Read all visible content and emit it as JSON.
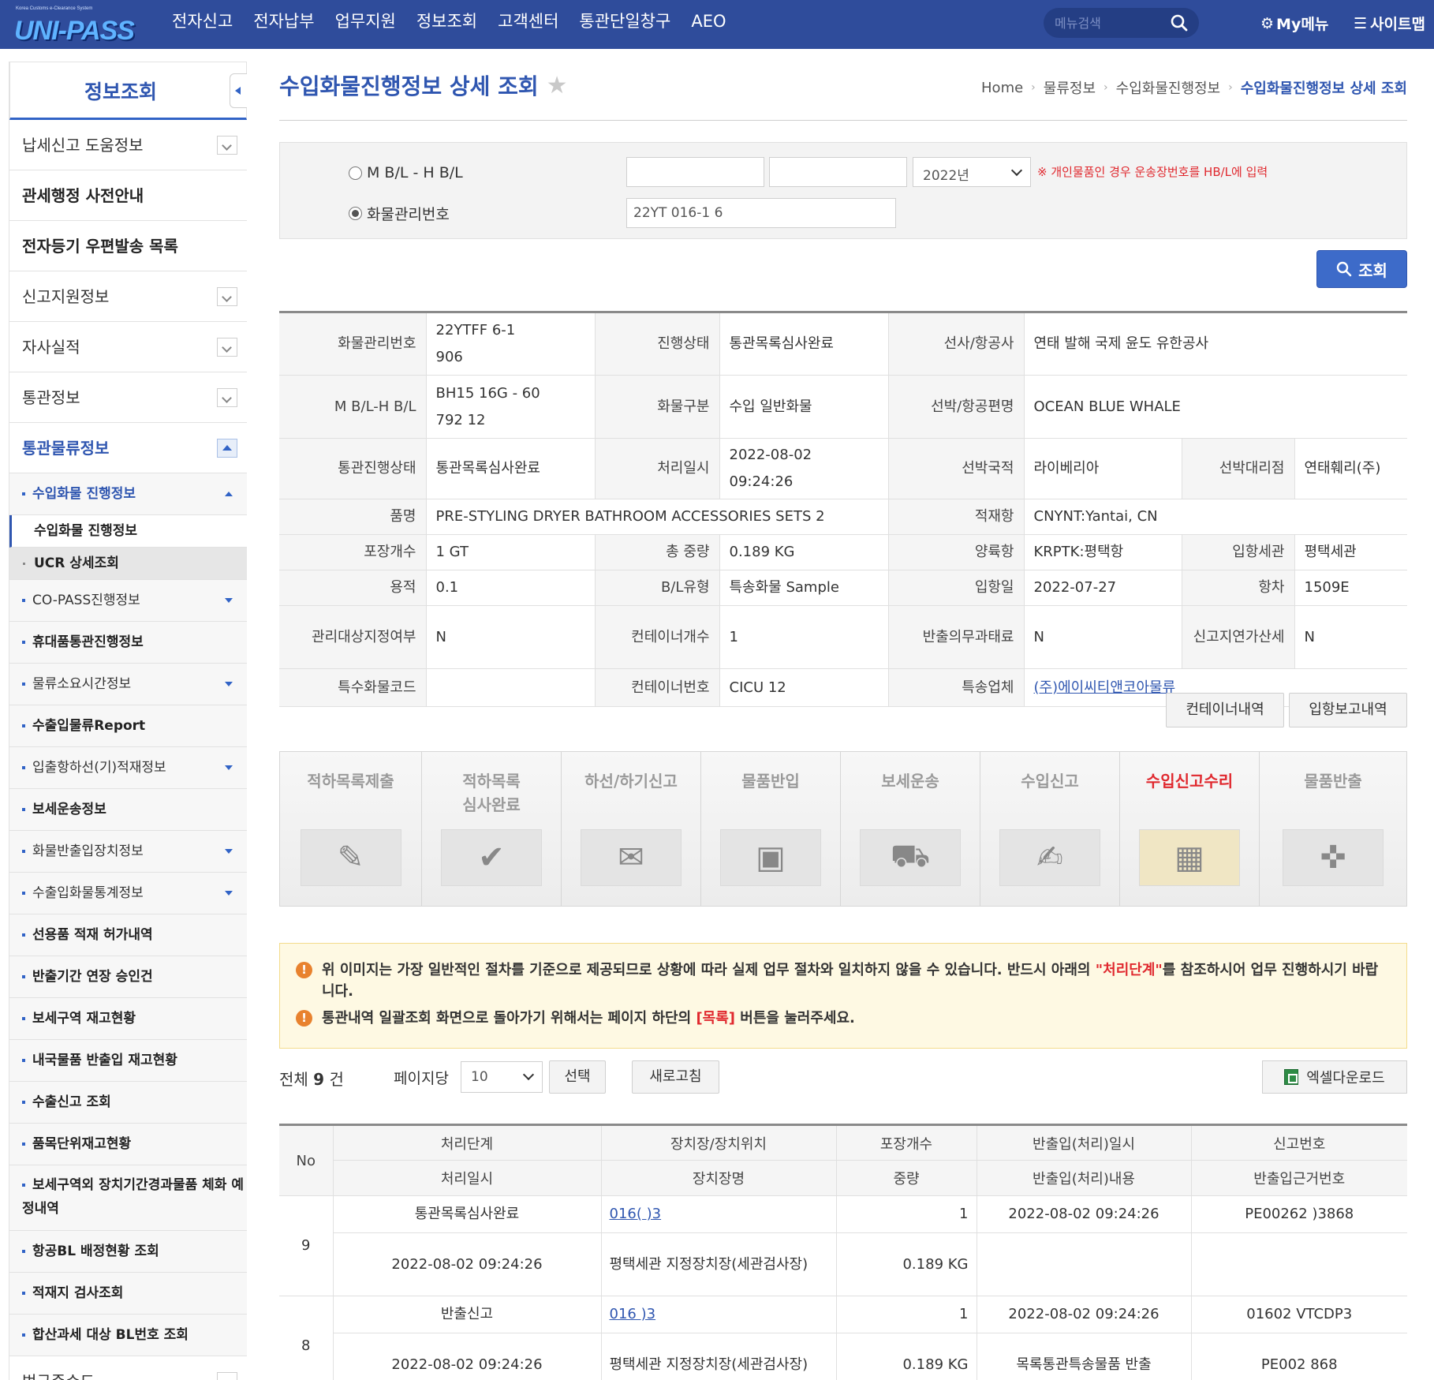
{
  "header": {
    "logo_small": "Korea Customs e-Clearance System",
    "logo_text": "UNI-PASS",
    "nav": [
      "전자신고",
      "전자납부",
      "업무지원",
      "정보조회",
      "고객센터",
      "통관단일창구",
      "AEO"
    ],
    "search_placeholder": "메뉴검색",
    "mymenu": "My메뉴",
    "sitemap": "사이트맵"
  },
  "sidebar": {
    "title": "정보조회",
    "items": [
      {
        "label": "납세신고 도움정보",
        "toggle": "down"
      },
      {
        "label": "관세행정 사전안내",
        "bold": true
      },
      {
        "label": "전자등기 우편발송 목록",
        "bold": true
      },
      {
        "label": "신고지원정보",
        "toggle": "down"
      },
      {
        "label": "자사실적",
        "toggle": "down"
      },
      {
        "label": "통관정보",
        "toggle": "down"
      },
      {
        "label": "통관물류정보",
        "toggle": "up",
        "active": true
      }
    ],
    "sub_open": "수입화물 진행정보",
    "sub_children": [
      "수입화물 진행정보",
      "UCR 상세조회"
    ],
    "subs": [
      "CO-PASS진행정보",
      "휴대품통관진행정보",
      "물류소요시간정보",
      "수출입물류Report",
      "입출항하선(기)적재정보",
      "보세운송정보",
      "화물반출입장치정보",
      "수출입화물통계정보",
      "선용품 적재 허가내역",
      "반출기간 연장 승인건",
      "보세구역 재고현황",
      "내국물품 반출입 재고현황",
      "수출신고 조회",
      "품목단위재고현황",
      "보세구역외 장치기간경과물품 체화 예정내역",
      "항공BL 배정현황 조회",
      "적재지 검사조회",
      "합산과세 대상 BL번호 조회"
    ],
    "last": "법규준수도"
  },
  "page": {
    "title": "수입화물진행정보 상세 조회",
    "breadcrumb": [
      "Home",
      "물류정보",
      "수입화물진행정보",
      "수입화물진행정보 상세 조회"
    ]
  },
  "search": {
    "radio1": "M B/L - H B/L",
    "radio2": "화물관리번호",
    "mbl": "",
    "hbl": "",
    "year": "2022년",
    "note": "※ 개인물품인 경우 운송장번호를 HB/L에 입력",
    "cargo_no": "22YT          016-1   6",
    "button": "조회"
  },
  "info": {
    "labels": {
      "cargo_no": "화물관리번호",
      "status": "진행상태",
      "carrier": "선사/항공사",
      "bl": "M B/L-H B/L",
      "cargo_type": "화물구분",
      "vessel": "선박/항공편명",
      "clearance": "통관진행상태",
      "proc_date": "처리일시",
      "nation": "선박국적",
      "agent": "선박대리점",
      "item": "품명",
      "load_port": "적재항",
      "pkg": "포장개수",
      "weight": "총 중량",
      "unload_port": "양륙항",
      "customs": "입항세관",
      "volume": "용적",
      "bl_type": "B/L유형",
      "arrival": "입항일",
      "voyage": "항차",
      "mgmt": "관리대상지정여부",
      "cntr_cnt": "컨테이너개수",
      "penalty": "반출의무과태료",
      "late": "신고지연가산세",
      "special": "특수화물코드",
      "cntr_no": "컨테이너번호",
      "courier": "특송업체"
    },
    "values": {
      "cargo_no": "22YTFF              6-1\n906",
      "status": "통관목록심사완료",
      "carrier": "연태 발해 국제 윤도 유한공사",
      "bl": "BH15        16G - 60\n792         12",
      "cargo_type": "수입 일반화물",
      "vessel": "OCEAN BLUE WHALE",
      "clearance": "통관목록심사완료",
      "proc_date": "2022-08-02 09:24:26",
      "nation": "라이베리아",
      "agent": "연태훼리(주)",
      "item": "PRE-STYLING DRYER BATHROOM ACCESSORIES SETS 2",
      "load_port": "CNYNT:Yantai, CN",
      "pkg": "1 GT",
      "weight": "0.189 KG",
      "unload_port": "KRPTK:평택항",
      "customs": "평택세관",
      "volume": "0.1",
      "bl_type": "특송화물 Sample",
      "arrival": "2022-07-27",
      "voyage": "1509E",
      "mgmt": "N",
      "cntr_cnt": "1",
      "penalty": "N",
      "late": "N",
      "special": "",
      "cntr_no": "CICU        12",
      "courier": "(주)에이씨티앤코아물류"
    }
  },
  "buttons": {
    "container": "컨테이너내역",
    "arrival_report": "입항보고내역"
  },
  "steps": [
    {
      "label": "적하목록제출",
      "icon": "✎"
    },
    {
      "label": "적하목록\n심사완료",
      "icon": "✔"
    },
    {
      "label": "하선/하기신고",
      "icon": "✉"
    },
    {
      "label": "물품반입",
      "icon": "▣"
    },
    {
      "label": "보세운송",
      "icon": "⛟"
    },
    {
      "label": "수입신고",
      "icon": "✍"
    },
    {
      "label": "수입신고수리",
      "icon": "▦",
      "active": true
    },
    {
      "label": "물품반출",
      "icon": "✜"
    }
  ],
  "notice": {
    "line1_a": "위 이미지는 가장 일반적인 절차를 기준으로 제공되므로 상황에 따라 실제 업무 절차와 일치하지 않을 수 있습니다. 반드시 아래의 ",
    "line1_red": "\"처리단계\"",
    "line1_b": "를 참조하시어 업무 진행하시기 바랍니다.",
    "line2_a": "통관내역 일괄조회 화면으로 돌아가기 위해서는 페이지 하단의 ",
    "line2_red": "[목록]",
    "line2_b": " 버튼을 눌러주세요."
  },
  "list": {
    "total_label": "전체",
    "total_count": "9",
    "total_unit": "건",
    "per_page_label": "페이지당",
    "per_page": "10",
    "select_btn": "선택",
    "refresh_btn": "새로고침",
    "excel_btn": "엑셀다운로드"
  },
  "grid": {
    "headers_top": [
      "No",
      "처리단계",
      "장치장/장치위치",
      "포장개수",
      "반출입(처리)일시",
      "신고번호"
    ],
    "headers_bottom": [
      "처리일시",
      "장치장명",
      "중량",
      "반출입(처리)내용",
      "반출입근거번호"
    ],
    "rows": [
      {
        "no": "9",
        "step": "통관목록심사완료",
        "location_code": "016(      )3",
        "pkg": "1",
        "io_date": "2022-08-02 09:24:26",
        "report_no": "PE00262          )3868",
        "proc_date": "2022-08-02 09:24:26",
        "location_name": "평택세관 지정장치장(세관검사장)",
        "weight": "0.189 KG",
        "io_content": "",
        "basis_no": ""
      },
      {
        "no": "8",
        "step": "반출신고",
        "location_code": "016       )3",
        "pkg": "1",
        "io_date": "2022-08-02 09:24:26",
        "report_no": "01602          VTCDP3",
        "proc_date": "2022-08-02 09:24:26",
        "location_name": "평택세관 지정장치장(세관검사장)",
        "weight": "0.189 KG",
        "io_content": "목록통관특송물품 반출",
        "basis_no": "PE002         868"
      }
    ]
  }
}
